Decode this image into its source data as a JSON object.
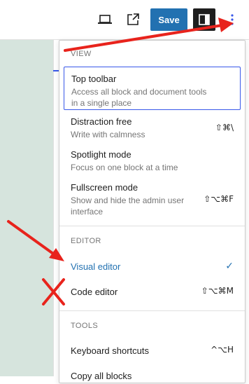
{
  "toolbar": {
    "save_label": "Save"
  },
  "menu": {
    "view_heading": "VIEW",
    "editor_heading": "EDITOR",
    "tools_heading": "TOOLS",
    "view_items": [
      {
        "label": "Top toolbar",
        "desc": "Access all block and document tools in a single place",
        "shortcut": ""
      },
      {
        "label": "Distraction free",
        "desc": "Write with calmness",
        "shortcut": "⇧⌘\\"
      },
      {
        "label": "Spotlight mode",
        "desc": "Focus on one block at a time",
        "shortcut": ""
      },
      {
        "label": "Fullscreen mode",
        "desc": "Show and hide the admin user interface",
        "shortcut": "⇧⌥⌘F"
      }
    ],
    "editor_items": [
      {
        "label": "Visual editor",
        "shortcut": "✓"
      },
      {
        "label": "Code editor",
        "shortcut": "⇧⌥⌘M"
      }
    ],
    "tools_items": [
      {
        "label": "Keyboard shortcuts",
        "shortcut": "^⌥H"
      },
      {
        "label": "Copy all blocks",
        "shortcut": ""
      }
    ]
  },
  "colors": {
    "accent": "#3858e9",
    "save_button": "#2271b1",
    "active_text": "#2271b1",
    "annotation_red": "#e8231c",
    "canvas_bg": "#d6e4dd"
  },
  "icons": {
    "preview": "laptop-icon",
    "external": "external-link-icon",
    "settings": "sidebar-toggle-icon",
    "options": "vertical-ellipsis-icon"
  }
}
